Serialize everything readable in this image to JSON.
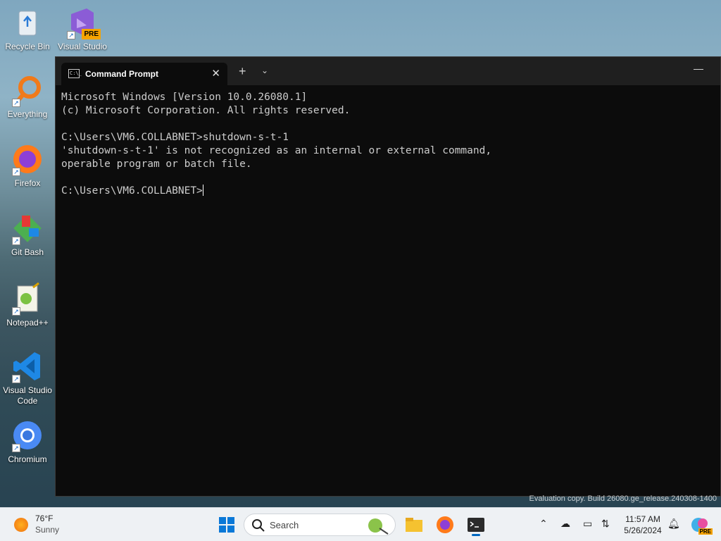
{
  "desktop": {
    "icons": [
      {
        "label": "Recycle Bin",
        "icon": "recycle-bin-icon"
      },
      {
        "label": "Visual Studio",
        "badge": "PRE",
        "icon": "visual-studio-preview-icon"
      },
      {
        "label": "Everything",
        "icon": "everything-search-icon"
      },
      {
        "label": "Firefox",
        "icon": "firefox-icon"
      },
      {
        "label": "Git Bash",
        "icon": "git-bash-icon"
      },
      {
        "label": "Notepad++",
        "icon": "notepad-plus-plus-icon"
      },
      {
        "label": "Visual Studio Code",
        "icon": "vscode-icon"
      },
      {
        "label": "Chromium",
        "icon": "chromium-icon"
      }
    ]
  },
  "window": {
    "tab_title": "Command Prompt",
    "tab_icon_text": "C:\\_",
    "close_tab": "✕",
    "new_tab": "+",
    "dropdown": "⌄",
    "minimize": "—"
  },
  "console": {
    "lines": [
      "Microsoft Windows [Version 10.0.26080.1]",
      "(c) Microsoft Corporation. All rights reserved.",
      "",
      "C:\\Users\\VM6.COLLABNET>shutdown-s-t-1",
      "'shutdown-s-t-1' is not recognized as an internal or external command,",
      "operable program or batch file.",
      ""
    ],
    "prompt": "C:\\Users\\VM6.COLLABNET>"
  },
  "watermark": "Evaluation copy. Build 26080.ge_release.240308-1400",
  "taskbar": {
    "weather_temp": "76°F",
    "weather_condition": "Sunny",
    "search_label": "Search",
    "time": "11:57 AM",
    "date": "5/26/2024",
    "copilot_badge": "PRE"
  },
  "colors": {
    "console_bg": "#0c0c0c",
    "console_text": "#cccccc",
    "taskbar_bg": "#eef1f4",
    "accent": "#0067c0"
  }
}
